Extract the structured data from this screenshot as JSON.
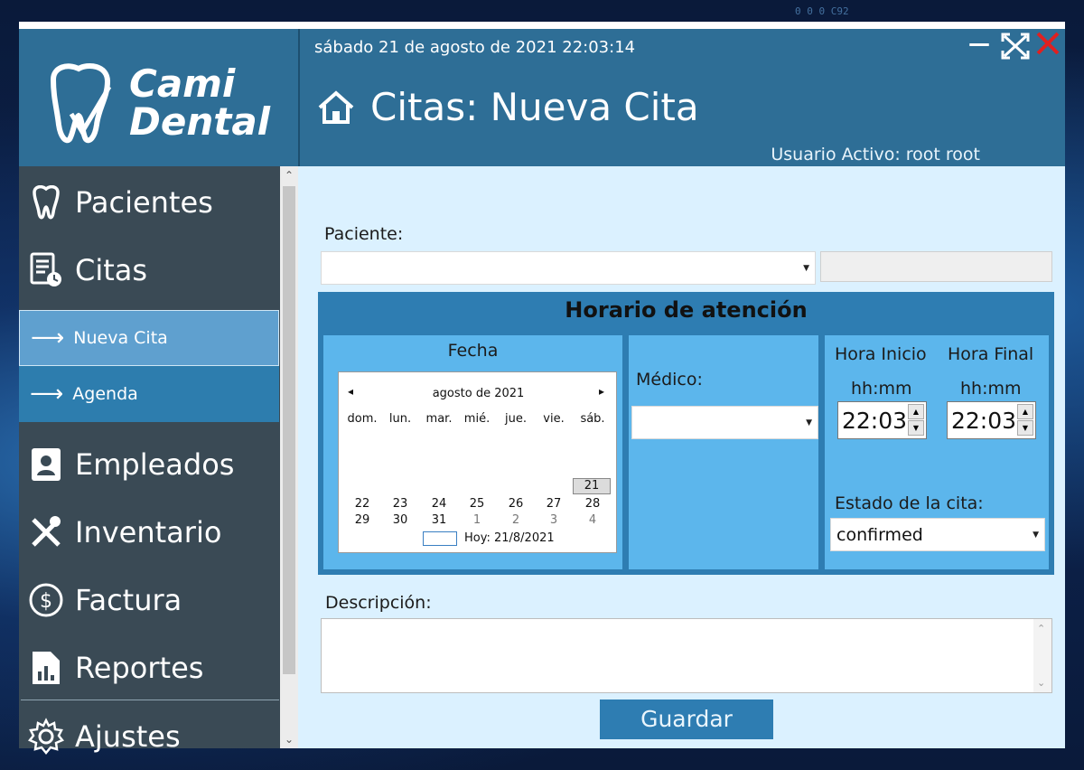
{
  "window": {
    "datetime": "sábado 21 de agosto de 2021   22:03:14",
    "title": "Citas: Nueva Cita",
    "active_user": "Usuario Activo:  root root"
  },
  "brand": {
    "line1": "Cami",
    "line2": "Dental"
  },
  "sidebar": {
    "items": [
      {
        "label": "Pacientes",
        "icon": "tooth-icon"
      },
      {
        "label": "Citas",
        "icon": "appointments-icon"
      },
      {
        "label": "Empleados",
        "icon": "badge-icon"
      },
      {
        "label": "Inventario",
        "icon": "tools-icon"
      },
      {
        "label": "Factura",
        "icon": "dollar-icon"
      },
      {
        "label": "Reportes",
        "icon": "report-icon"
      },
      {
        "label": "Ajustes",
        "icon": "gear-icon"
      }
    ],
    "subitems": [
      {
        "label": "Nueva Cita",
        "active": true
      },
      {
        "label": "Agenda",
        "active": false
      }
    ]
  },
  "form": {
    "patient_label": "Paciente:",
    "patient_value": "",
    "schedule_title": "Horario de atención",
    "date_label": "Fecha",
    "doctor_label": "Médico:",
    "doctor_value": "",
    "start_label": "Hora Inicio",
    "end_label": "Hora Final",
    "format_label": "hh:mm",
    "start_value": "22:03",
    "end_value": "22:03",
    "status_label": "Estado de la cita:",
    "status_value": "confirmed",
    "description_label": "Descripción:",
    "description_value": "",
    "save_label": "Guardar"
  },
  "calendar": {
    "month": "agosto de 2021",
    "weekdays": [
      "dom.",
      "lun.",
      "mar.",
      "mié.",
      "jue.",
      "vie.",
      "sáb."
    ],
    "selected": "21",
    "row1": [
      "22",
      "23",
      "24",
      "25",
      "26",
      "27",
      "28"
    ],
    "row2": [
      "29",
      "30",
      "31",
      "1",
      "2",
      "3",
      "4"
    ],
    "today": "Hoy: 21/8/2021"
  },
  "colors": {
    "header": "#2e6e96",
    "sidebar": "#3a4a55",
    "accent": "#2e7db2",
    "panel": "#5cb6ec",
    "close": "#e02020"
  }
}
